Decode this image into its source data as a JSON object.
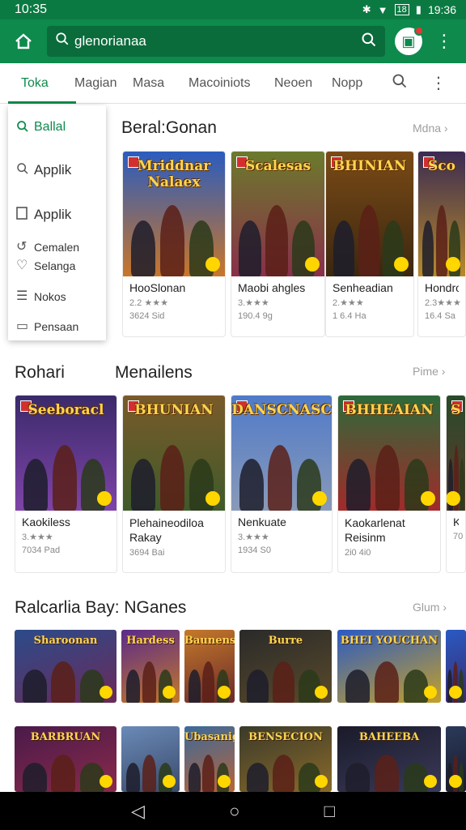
{
  "status": {
    "time": "10:35",
    "right_time": "19:36",
    "battery_label": "18"
  },
  "search": {
    "query": "glenorianaa"
  },
  "tabs": [
    {
      "label": "Toka",
      "active": true
    },
    {
      "label": "Magian",
      "active": false
    },
    {
      "label": "Masa",
      "active": false
    },
    {
      "label": "Macoiniots",
      "active": false
    },
    {
      "label": "Neoen",
      "active": false
    },
    {
      "label": "Nopp",
      "active": false
    }
  ],
  "menu": [
    {
      "label": "Ballal",
      "icon": "search-icon",
      "active": true
    },
    {
      "label": "Applik",
      "icon": "search-icon",
      "active": false
    },
    {
      "label": "Applik",
      "icon": "bookmark-icon",
      "active": false
    },
    {
      "label": "Cemalen",
      "icon": "refresh-icon",
      "active": false
    },
    {
      "label": "Selanga",
      "icon": "heart-icon",
      "active": false
    },
    {
      "label": "Nokos",
      "icon": "list-icon",
      "active": false
    },
    {
      "label": "Pensaan",
      "icon": "card-icon",
      "active": false
    }
  ],
  "section1": {
    "title": "Beral:Gonan",
    "more": "Mdna ›",
    "cards": [
      {
        "art_title": "Mriddnar Nalaex",
        "name": "HooSlonan",
        "rating": "2.2 ★★★",
        "size": "3624 Sid",
        "color_top": "#2a5cbf",
        "color_bottom": "#c9762a"
      },
      {
        "art_title": "Scalesas",
        "name": "Maobi ahgles",
        "rating": "3.★★★",
        "size": "190.4 9g",
        "color_top": "#6b7a2c",
        "color_bottom": "#8a2f4a"
      },
      {
        "art_title": "BHINIAN",
        "name": "Senheadian",
        "rating": "2.★★★",
        "size": "1 6.4 Ha",
        "color_top": "#7a4a16",
        "color_bottom": "#3b2710"
      },
      {
        "art_title": "Sco",
        "name": "Hondroo",
        "rating": "2.3★★★",
        "size": "16.4 Sa",
        "color_top": "#3b2b52",
        "color_bottom": "#b88a2a"
      }
    ]
  },
  "section2": {
    "title_left": "Rohari",
    "title_right": "Menailens",
    "more": "Pime ›",
    "cards": [
      {
        "art_title": "Seeboracl",
        "name": "Kaokiless",
        "rating": "3.★★★",
        "size": "7034 Pad",
        "color_top": "#3a2a6a",
        "color_bottom": "#7e44a8"
      },
      {
        "art_title": "BHUNIAN",
        "name": "Plehaineodiloa Rakay",
        "rating": "",
        "size": "3694 Bai",
        "color_top": "#7a5a2a",
        "color_bottom": "#3f5a2a"
      },
      {
        "art_title": "DANSCNASC",
        "name": "Nenkuate",
        "rating": "3.★★★",
        "size": "1934 S0",
        "color_top": "#4f7ac9",
        "color_bottom": "#8a9ab8"
      },
      {
        "art_title": "BHHEAIAN",
        "name": "Kaokarlenat Reisinm",
        "rating": "",
        "size": "2i0 4i0",
        "color_top": "#2d6a3a",
        "color_bottom": "#a22a2a"
      },
      {
        "art_title": "S",
        "name": "Ka",
        "rating": "",
        "size": "70",
        "color_top": "#2a4a2a",
        "color_bottom": "#5a3a2a"
      }
    ]
  },
  "section3": {
    "title": "Ralcarlia Bay: NGanes",
    "more": "Glum ›",
    "row1": [
      {
        "art_title": "Sharoonan",
        "c1": "#2b4b8a",
        "c2": "#6a2a5a"
      },
      {
        "art_title": "Hardess",
        "c1": "#5a2a8a",
        "c2": "#c4792a"
      },
      {
        "art_title": "Baunens",
        "c1": "#c4792a",
        "c2": "#6a2a2a"
      },
      {
        "art_title": "Burre",
        "c1": "#2a2a2a",
        "c2": "#5a4a2a"
      },
      {
        "art_title": "BHEI YOUCHAN",
        "c1": "#2a5ac4",
        "c2": "#c4a02a"
      },
      {
        "art_title": "",
        "c1": "#2a5ac4",
        "c2": "#3a2a6a"
      }
    ],
    "row2": [
      {
        "art_title": "BARBRUAN",
        "c1": "#4a1a4a",
        "c2": "#8a2a4a"
      },
      {
        "art_title": "",
        "c1": "#6a8ab8",
        "c2": "#3a4a6a"
      },
      {
        "art_title": "Ubasanig",
        "c1": "#3a6a9a",
        "c2": "#b8643a"
      },
      {
        "art_title": "BENSECION",
        "c1": "#3a3a2a",
        "c2": "#8a6a2a"
      },
      {
        "art_title": "BAHEEBA",
        "c1": "#1a1a2a",
        "c2": "#3a3a5a"
      },
      {
        "art_title": "",
        "c1": "#2a3a5a",
        "c2": "#1a1a2a"
      }
    ]
  }
}
